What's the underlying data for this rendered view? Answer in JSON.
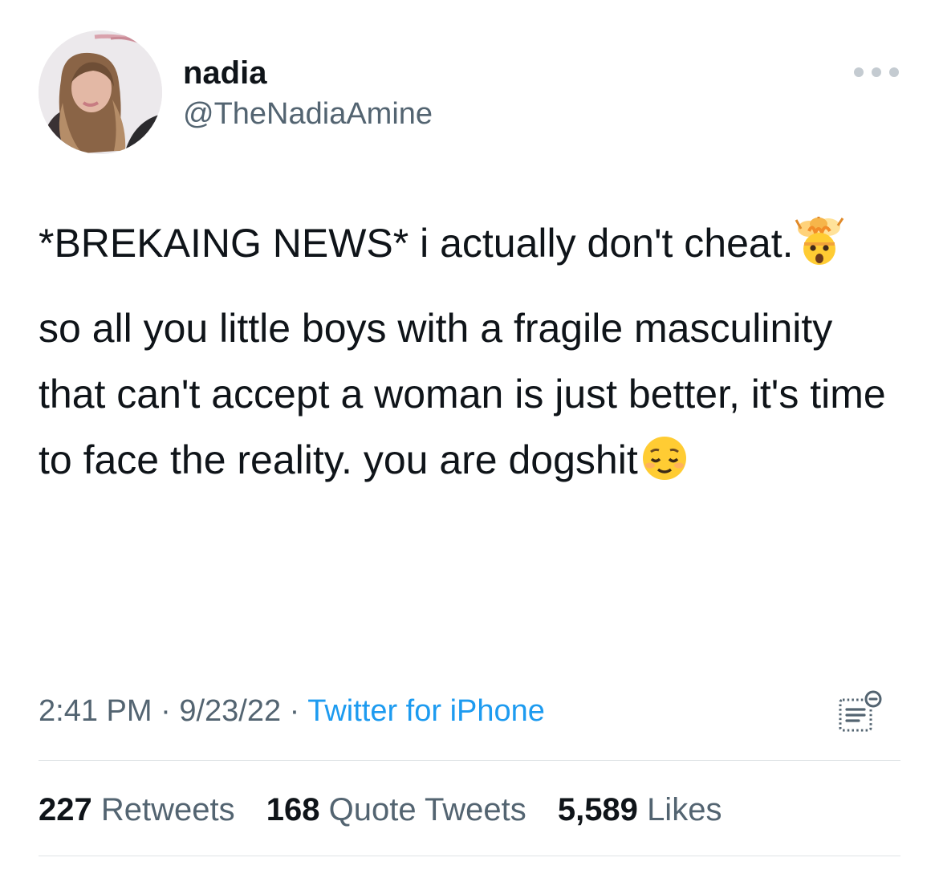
{
  "user": {
    "display_name": "nadia",
    "handle": "@TheNadiaAmine",
    "avatar_icon": "profile-photo"
  },
  "tweet": {
    "paragraph_1": "*BREKAING NEWS* i actually don't cheat.",
    "paragraph_1_emoji": "exploding-head-emoji",
    "paragraph_2": "so all you little boys with a fragile masculinity that can't accept a woman is just better, it's time to face the reality. you are dogshit",
    "paragraph_2_emoji": "relieved-face-emoji"
  },
  "meta": {
    "time": "2:41 PM",
    "separator": "·",
    "date": "9/23/22",
    "source": "Twitter for iPhone"
  },
  "stats": {
    "retweets_count": "227",
    "retweets_label": "Retweets",
    "quotes_count": "168",
    "quotes_label": "Quote Tweets",
    "likes_count": "5,589",
    "likes_label": "Likes"
  },
  "colors": {
    "text": "#0f1419",
    "secondary": "#536471",
    "link": "#1d9bf0",
    "divider": "#dfe3e6"
  }
}
